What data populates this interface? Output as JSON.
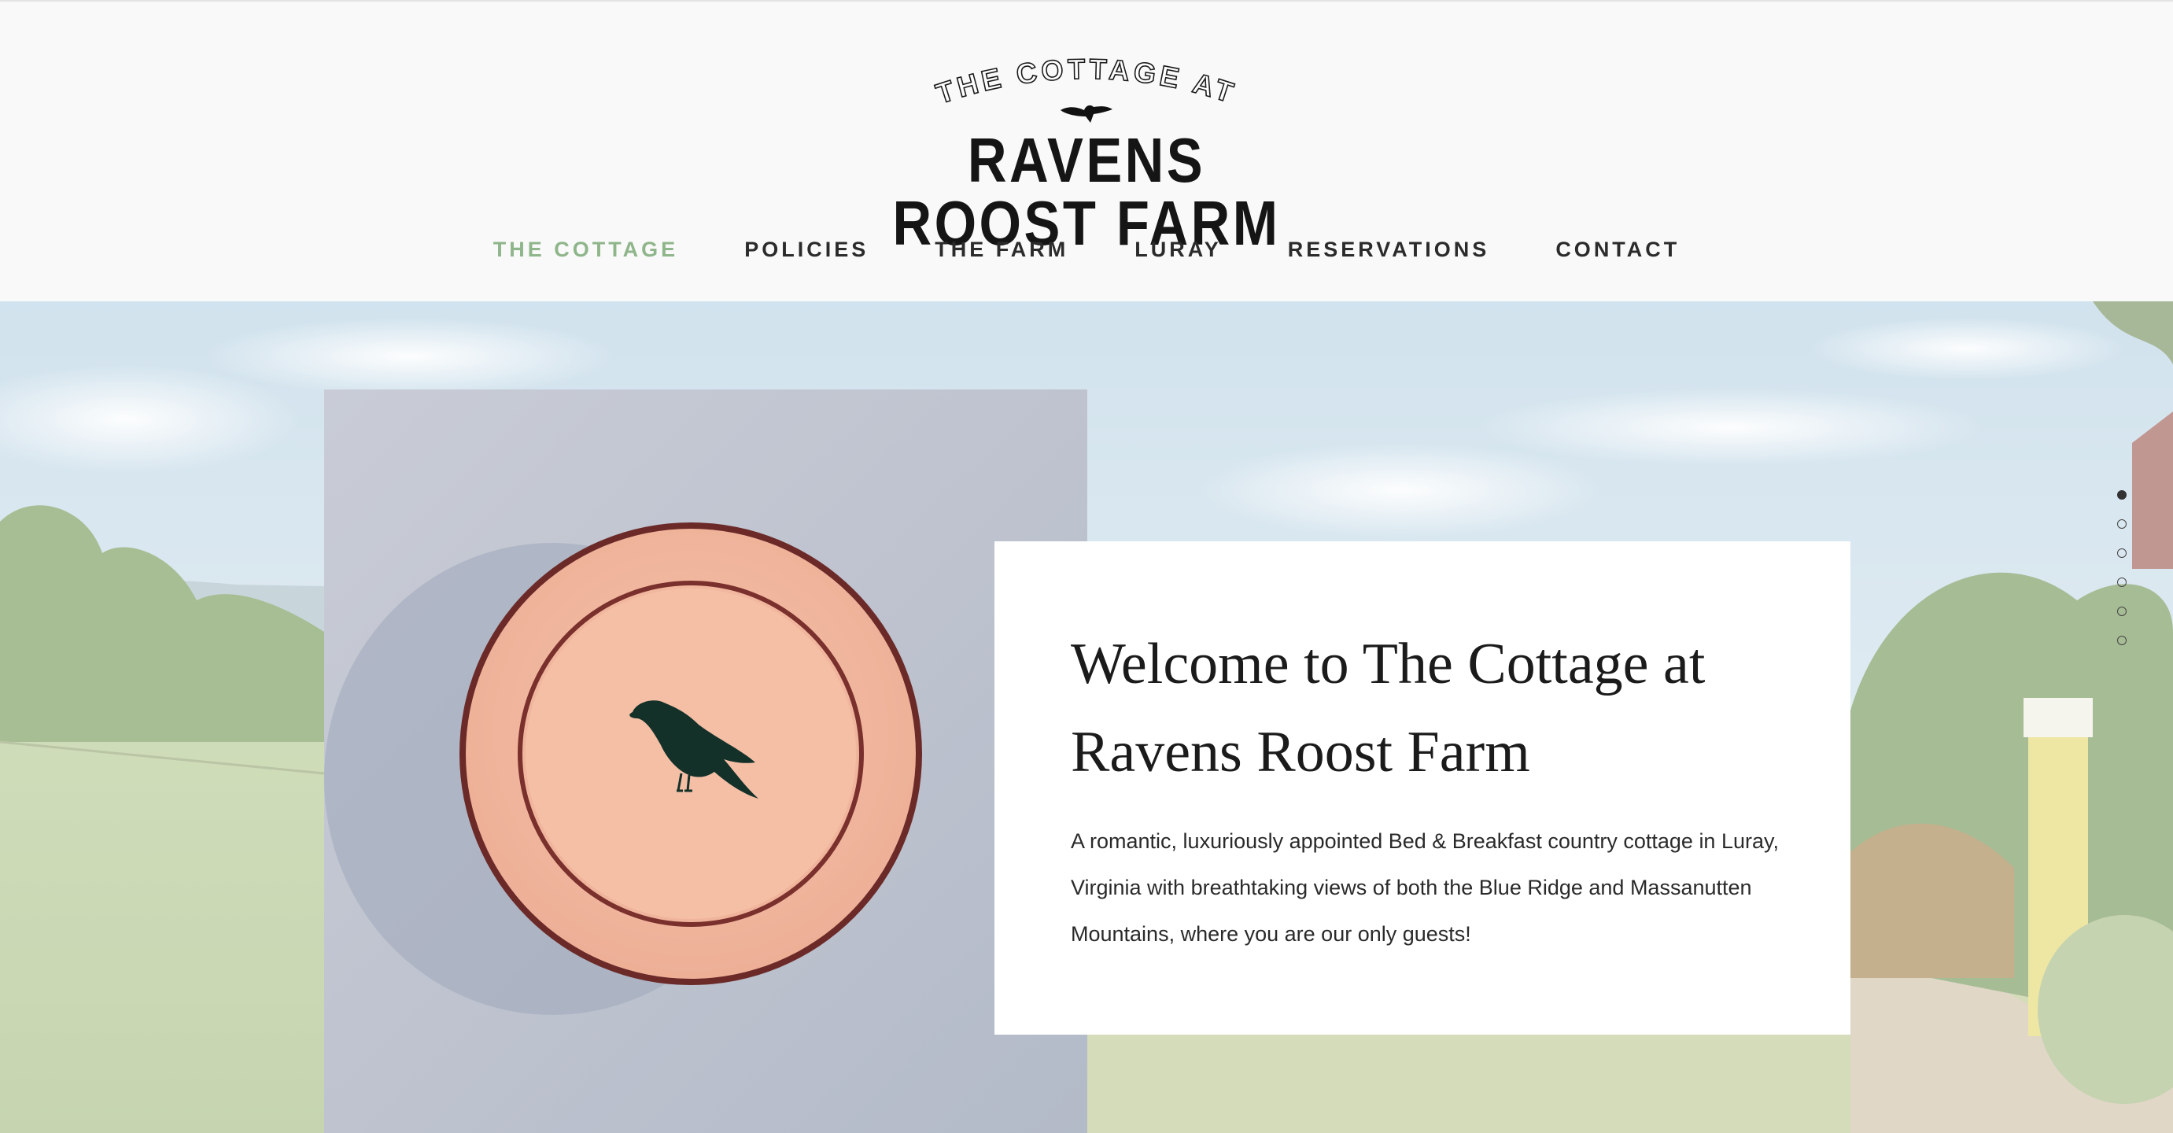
{
  "logo": {
    "top_text": "THE COTTAGE AT",
    "main_text": "RAVENS ROOST FARM",
    "mark": "raven-icon"
  },
  "nav": {
    "items": [
      {
        "label": "THE COTTAGE",
        "active": true
      },
      {
        "label": "POLICIES",
        "active": false
      },
      {
        "label": "THE FARM",
        "active": false
      },
      {
        "label": "LURAY",
        "active": false
      },
      {
        "label": "RESERVATIONS",
        "active": false
      },
      {
        "label": "CONTACT",
        "active": false
      }
    ]
  },
  "hero": {
    "title": "Welcome to The Cottage at Ravens Roost Farm",
    "body": "A romantic, luxuriously appointed Bed & Breakfast country cottage in Luray, Virginia with breathtaking views of both the Blue Ridge and Massanutten Mountains, where you are our only guests!",
    "slides": {
      "count": 6,
      "active": 1
    }
  },
  "colors": {
    "accent": "#8fb58a",
    "text": "#1b1b1b",
    "plate": "#f2b79f",
    "plate_rim": "#6e2c2a",
    "raven": "#123028"
  }
}
